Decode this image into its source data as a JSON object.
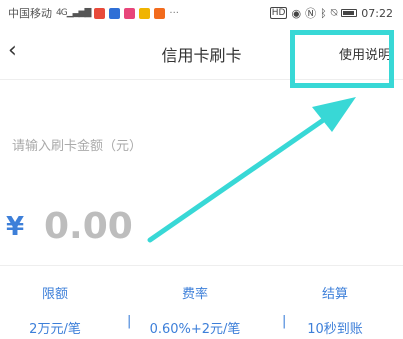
{
  "status_bar": {
    "carrier": "中国移动",
    "signal_glyph": "4G▁▃▅▇",
    "more": "···",
    "icons": [
      "hd-icon",
      "eye-icon",
      "nfc-icon",
      "bluetooth-icon",
      "mute-icon",
      "battery-icon"
    ],
    "hd": "HD",
    "time": "07:22"
  },
  "nav": {
    "title": "信用卡刷卡",
    "help_label": "使用说明"
  },
  "amount": {
    "label": "请输入刷卡金额（元）",
    "currency": "¥",
    "value": "0.00"
  },
  "info": {
    "limit_label": "限额",
    "limit_value": "2万元/笔",
    "rate_label": "费率",
    "rate_value": "0.60%+2元/笔",
    "settle_label": "结算",
    "settle_value": "10秒到账",
    "separator": "|"
  },
  "colors": {
    "accent": "#3d7fd9",
    "annotation": "#38d8d6"
  }
}
